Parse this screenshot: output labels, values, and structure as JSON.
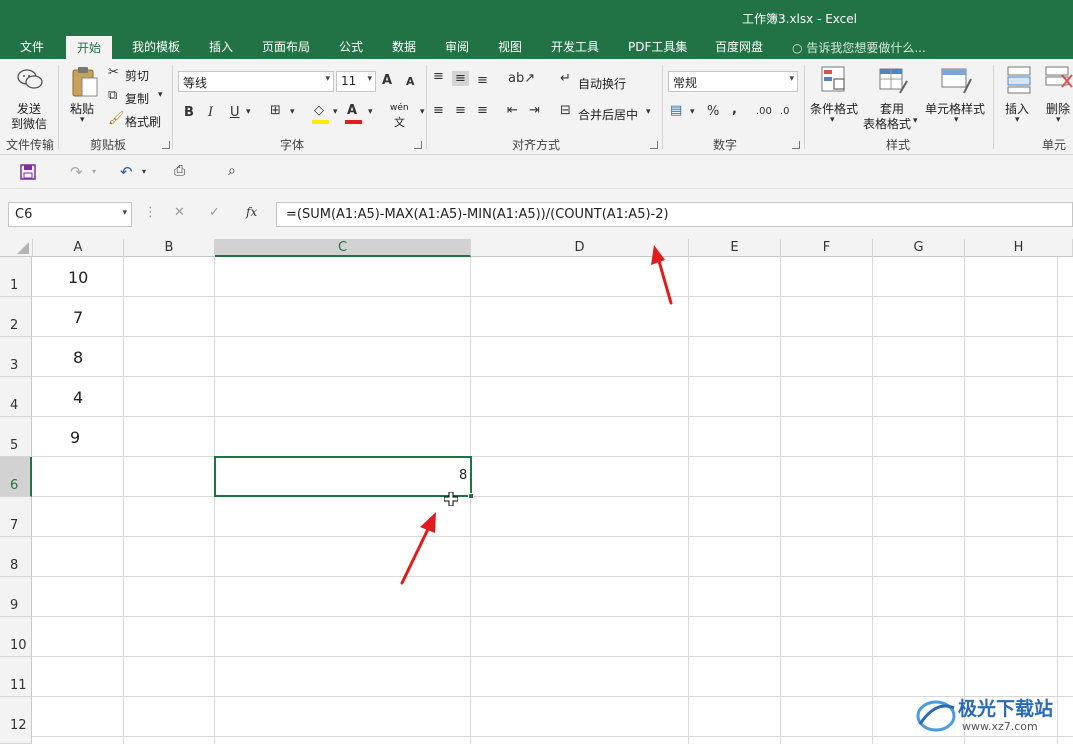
{
  "window": {
    "title": "工作簿3.xlsx - Excel"
  },
  "tabs": [
    {
      "label": "文件",
      "active": false
    },
    {
      "label": "开始",
      "active": true
    },
    {
      "label": "我的模板",
      "active": false
    },
    {
      "label": "插入",
      "active": false
    },
    {
      "label": "页面布局",
      "active": false
    },
    {
      "label": "公式",
      "active": false
    },
    {
      "label": "数据",
      "active": false
    },
    {
      "label": "审阅",
      "active": false
    },
    {
      "label": "视图",
      "active": false
    },
    {
      "label": "开发工具",
      "active": false
    },
    {
      "label": "PDF工具集",
      "active": false
    },
    {
      "label": "百度网盘",
      "active": false
    }
  ],
  "tell_me": "告诉我您想要做什么...",
  "ribbon": {
    "wechat": {
      "line1": "发送",
      "line2": "到微信",
      "group": "文件传输"
    },
    "clipboard": {
      "paste": "粘贴",
      "cut": "剪切",
      "copy": "复制",
      "format_painter": "格式刷",
      "group": "剪贴板"
    },
    "font": {
      "name": "等线",
      "size": "11",
      "grow": "A",
      "shrink": "A",
      "bold": "B",
      "italic": "I",
      "underline": "U",
      "wen": "wén",
      "wen_char": "文",
      "group": "字体"
    },
    "alignment": {
      "wrap": "自动换行",
      "merge": "合并后居中",
      "group": "对齐方式"
    },
    "number": {
      "format": "常规",
      "percent": "%",
      "comma": ",",
      "inc_dec": ".00",
      "dec_dec": ".0",
      "group": "数字"
    },
    "styles": {
      "conditional": "条件格式",
      "table_1": "套用",
      "table_2": "表格格式",
      "cell_styles": "单元格样式",
      "group": "样式"
    },
    "cells": {
      "insert": "插入",
      "delete": "删除",
      "group": "单元格"
    }
  },
  "formula_bar": {
    "name_box": "C6",
    "fx": "fx",
    "formula": "=(SUM(A1:A5)-MAX(A1:A5)-MIN(A1:A5))/(COUNT(A1:A5)-2)"
  },
  "sheet": {
    "columns": [
      "A",
      "B",
      "C",
      "D",
      "E",
      "F",
      "G",
      "H"
    ],
    "rows": [
      "1",
      "2",
      "3",
      "4",
      "5",
      "6",
      "7",
      "8",
      "9",
      "10",
      "11",
      "12"
    ],
    "values": {
      "A1": "10",
      "A2": "7",
      "A3": "8",
      "A4": "4",
      "A5": "9"
    },
    "selected_value": "8"
  },
  "watermark": {
    "text": "极光下载站",
    "url": "www.xz7.com"
  },
  "colors": {
    "accent": "#217346",
    "arrow": "#e01c1c"
  }
}
